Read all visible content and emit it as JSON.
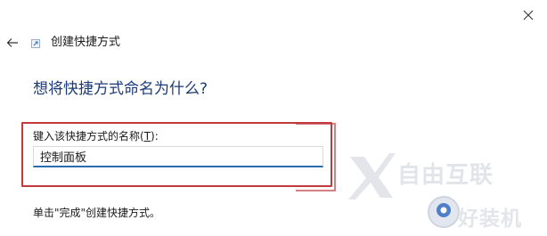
{
  "window": {
    "close_icon": "close-icon"
  },
  "nav": {
    "back_icon": "back-arrow-icon"
  },
  "header": {
    "app_icon": "shortcut-app-icon",
    "title": "创建快捷方式"
  },
  "main": {
    "question": "想将快捷方式命名为什么?",
    "field_label_prefix": "键入该快捷方式的名称(",
    "field_label_accel": "T",
    "field_label_suffix": "):",
    "name_value": "控制面板",
    "hint": "单击\"完成\"创建快捷方式。"
  },
  "overlays": {
    "watermark_text": "自由互联",
    "badge_text": "好装机"
  },
  "colors": {
    "question_text": "#1b3a78",
    "highlight_border": "#c33a3e",
    "input_underline": "#2b6cb0"
  }
}
